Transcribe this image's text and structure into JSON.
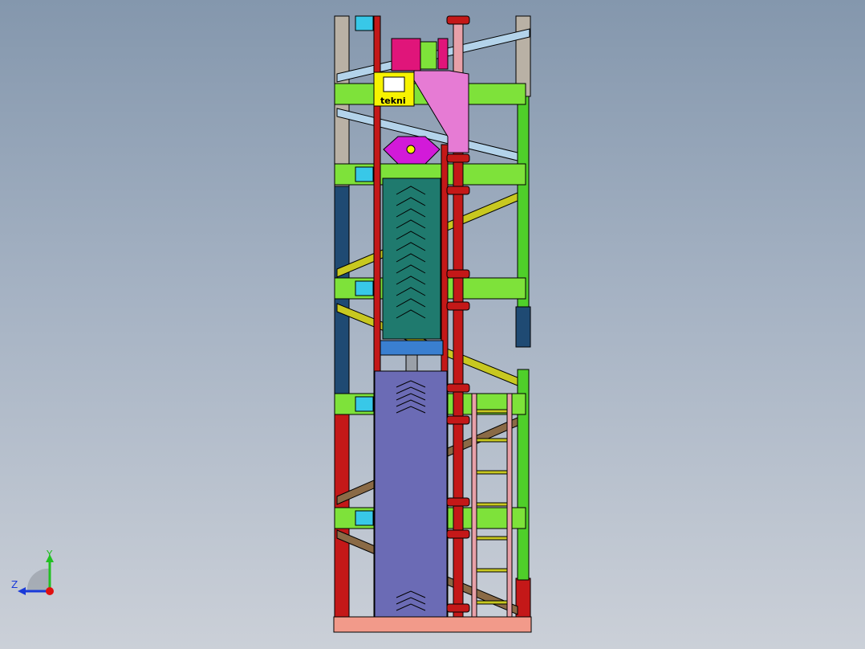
{
  "viewport": {
    "background_top": "#8497ad",
    "background_bottom": "#cbd0d8"
  },
  "model": {
    "name_plate_text": "tekni",
    "colors": {
      "frame_gray": "#b9b1a5",
      "frame_blue": "#1f4a73",
      "frame_red": "#c41818",
      "crossbar_green": "#7ee23a",
      "brace_lightblue": "#b3d3ea",
      "brace_olive": "#c8c820",
      "brace_brown": "#8a6a46",
      "chute_teal": "#1f7a6e",
      "bin_purple": "#6b6bb5",
      "motor_magenta": "#e0157a",
      "bracket_pink": "#e67bd4",
      "pulley_magenta": "#d21ad9",
      "nameplate_yellow": "#f7f300",
      "base_salmon": "#f29a8a",
      "ladder_pink": "#e8a0a8",
      "rail_green": "#4fcf2a",
      "clamp_cyan": "#38c8e8",
      "clamp_blue": "#3a7fd0"
    }
  },
  "triad": {
    "y_label": "Y",
    "z_label": "Z",
    "y_color": "#22c022",
    "z_color": "#1a3ad9",
    "x_color": "#e01010"
  }
}
